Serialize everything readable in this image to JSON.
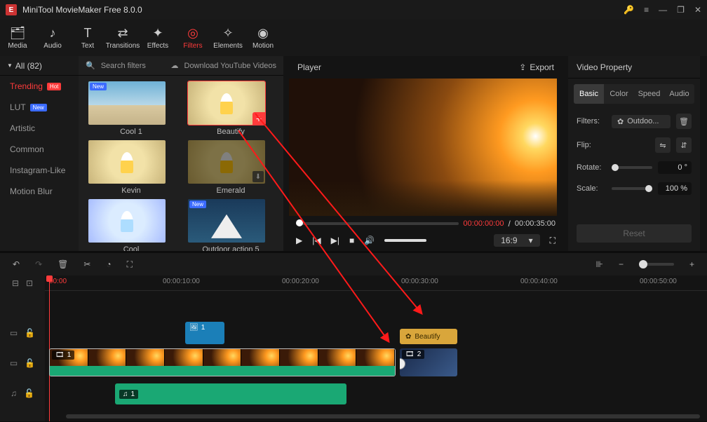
{
  "app": {
    "title": "MiniTool MovieMaker Free 8.0.0"
  },
  "toolbar": {
    "tabs": [
      "Media",
      "Audio",
      "Text",
      "Transitions",
      "Effects",
      "Filters",
      "Elements",
      "Motion"
    ],
    "active": "Filters"
  },
  "sidebar": {
    "header": "All (82)",
    "items": [
      {
        "label": "Trending",
        "badge": "Hot",
        "active": true
      },
      {
        "label": "LUT",
        "badge": "New"
      },
      {
        "label": "Artistic"
      },
      {
        "label": "Common"
      },
      {
        "label": "Instagram-Like"
      },
      {
        "label": "Motion Blur"
      }
    ]
  },
  "filter_panel": {
    "search_placeholder": "Search filters",
    "download_label": "Download YouTube Videos",
    "cards": [
      {
        "name": "Cool 1",
        "tag": "New",
        "style": "sky"
      },
      {
        "name": "Beautify",
        "selected": true,
        "plus": true,
        "style": "field"
      },
      {
        "name": "Kevin",
        "style": "field"
      },
      {
        "name": "Emerald",
        "dl": true,
        "style": "dark"
      },
      {
        "name": "Cool",
        "style": "cool"
      },
      {
        "name": "Outdoor action 5",
        "tag": "New",
        "style": "tent"
      }
    ]
  },
  "player": {
    "title": "Player",
    "export": "Export",
    "time_current": "00:00:00:00",
    "time_total": "00:00:35:00",
    "aspect": "16:9"
  },
  "props": {
    "title": "Video Property",
    "tabs": [
      "Basic",
      "Color",
      "Speed",
      "Audio"
    ],
    "active": "Basic",
    "filters_label": "Filters:",
    "filter_value": "Outdoo...",
    "flip_label": "Flip:",
    "rotate_label": "Rotate:",
    "rotate_value": "0 °",
    "scale_label": "Scale:",
    "scale_value": "100 %",
    "reset": "Reset"
  },
  "timeline": {
    "ruler": {
      "start": "00:00",
      "marks": [
        "00:00:10:00",
        "00:00:20:00",
        "00:00:30:00",
        "00:00:40:00",
        "00:00:50:00"
      ]
    },
    "image_clip": "1",
    "filter_clip": "Beautify",
    "video_clip_1": "1",
    "video_clip_2": "2",
    "audio_clip": "1"
  }
}
